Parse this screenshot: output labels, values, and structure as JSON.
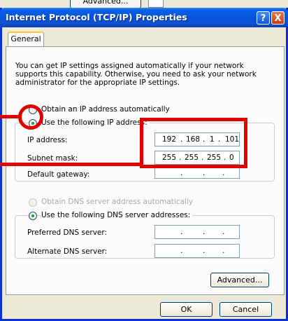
{
  "background": {
    "advanced_label": "Advanced..."
  },
  "window": {
    "title": "Internet Protocol (TCP/IP) Properties",
    "help_glyph": "?",
    "close_glyph": "X"
  },
  "tab": {
    "label": "General"
  },
  "intro_text": "You can get IP settings assigned automatically if your network supports this capability. Otherwise, you need to ask your network administrator for the appropriate IP settings.",
  "ip_mode": {
    "auto_label": "Obtain an IP address automatically",
    "manual_label": "Use the following IP address:",
    "selected": "manual"
  },
  "ip_fields": {
    "ip_address": {
      "label": "IP address:",
      "octets": [
        "192",
        "168",
        "1",
        "101"
      ]
    },
    "subnet_mask": {
      "label": "Subnet mask:",
      "octets": [
        "255",
        "255",
        "255",
        "0"
      ]
    },
    "default_gateway": {
      "label": "Default gateway:",
      "octets": [
        "",
        "",
        "",
        ""
      ]
    }
  },
  "dns_mode": {
    "auto_label": "Obtain DNS server address automatically",
    "manual_label": "Use the following DNS server addresses:",
    "selected": "manual"
  },
  "dns_fields": {
    "preferred": {
      "label": "Preferred DNS server:",
      "octets": [
        "",
        "",
        "",
        ""
      ]
    },
    "alternate": {
      "label": "Alternate DNS server:",
      "octets": [
        "",
        "",
        "",
        ""
      ]
    }
  },
  "buttons": {
    "advanced": "Advanced...",
    "ok": "OK",
    "cancel": "Cancel"
  },
  "colors": {
    "annotation_red": "#e00000",
    "titlebar_blue": "#0553da",
    "dialog_bg": "#ece9d8"
  }
}
